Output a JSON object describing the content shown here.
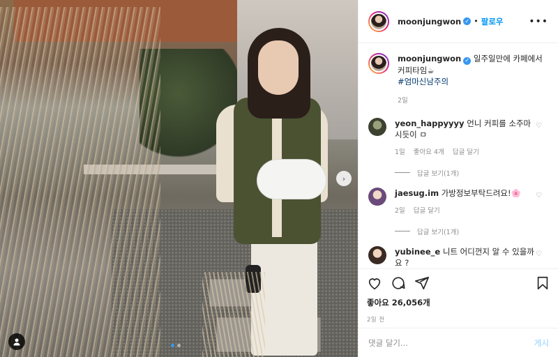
{
  "post": {
    "username": "moonjungwon",
    "follow_label": "팔로우",
    "more_label": "•••",
    "caption_text": "일주일만에 카페에서 커피타임☕",
    "hashtag": "#엄마신남주의",
    "caption_time": "2일",
    "likes_label": "좋아요 26,056개",
    "post_time": "2일 전"
  },
  "comments": [
    {
      "username": "yeon_happyyyy",
      "text": "언니 커피를 소주마시듯이 ㅁ",
      "time": "1일",
      "likes": "좋아요 4개",
      "reply": "답글 달기",
      "view_replies": "답글 보기(1개)"
    },
    {
      "username": "jaesug.im",
      "text": "가방정보부탁드려요!🌸",
      "time": "2일",
      "reply": "답글 달기",
      "view_replies": "답글 보기(1개)"
    },
    {
      "username": "yubinee_e",
      "text": "니트 어디껀지 알 수 있을까요 ?"
    }
  ],
  "add_comment": {
    "placeholder": "댓글 달기...",
    "post_label": "게시"
  },
  "icons": [
    "heart-icon",
    "comment-icon",
    "share-icon",
    "bookmark-icon",
    "user-tag-icon",
    "chevron-right-icon"
  ],
  "colors": {
    "accent": "#0095f6",
    "verified": "#3897f0",
    "muted": "#8e8e8e"
  }
}
